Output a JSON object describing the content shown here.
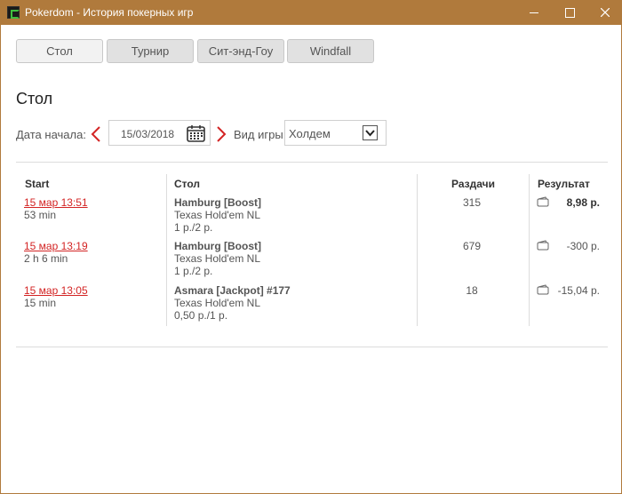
{
  "window": {
    "title": "Pokerdom - История покерных игр",
    "controls": [
      "minimize",
      "maximize",
      "close"
    ]
  },
  "tabs": [
    {
      "label": "Стол",
      "active": true
    },
    {
      "label": "Турнир",
      "active": false
    },
    {
      "label": "Сит-энд-Гоу",
      "active": false
    },
    {
      "label": "Windfall",
      "active": false
    }
  ],
  "section_title": "Стол",
  "filters": {
    "start_date_label": "Дата начала:",
    "start_date_value": "15/03/2018",
    "game_type_label": "Вид игры:",
    "game_type_value": "Холдем"
  },
  "table": {
    "headers": {
      "start": "Start",
      "table": "Стол",
      "hands": "Раздачи",
      "result": "Результат"
    },
    "rows": [
      {
        "start": "15 мар 13:51",
        "duration": "53 min",
        "table_name": "Hamburg [Boost]",
        "game": "Texas Hold'em NL",
        "stakes": "1 р./2 р.",
        "hands": "315",
        "result": "8,98 р.",
        "result_bold": true
      },
      {
        "start": "15 мар 13:19",
        "duration": "2 h 6 min",
        "table_name": "Hamburg [Boost]",
        "game": "Texas Hold'em NL",
        "stakes": "1 р./2 р.",
        "hands": "679",
        "result": "-300 р.",
        "result_bold": false
      },
      {
        "start": "15 мар 13:05",
        "duration": "15 min",
        "table_name": "Asmara [Jackpot] #177",
        "game": "Texas Hold'em NL",
        "stakes": "0,50 р./1 р.",
        "hands": "18",
        "result": "-15,04 р.",
        "result_bold": false
      }
    ]
  },
  "colors": {
    "titlebar": "#b07a3c",
    "link": "#d32424",
    "arrow": "#d32424"
  },
  "icons": {
    "prev": "chevron-left-icon",
    "next": "chevron-right-icon",
    "calendar": "calendar-icon",
    "dropdown": "chevron-down-icon",
    "wallet": "wallet-icon"
  }
}
